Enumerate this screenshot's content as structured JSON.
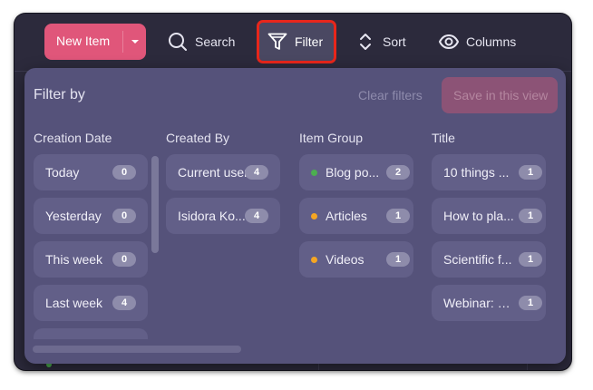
{
  "toolbar": {
    "new_item_label": "New Item",
    "search_label": "Search",
    "filter_label": "Filter",
    "sort_label": "Sort",
    "columns_label": "Columns"
  },
  "filter_panel": {
    "title": "Filter by",
    "clear_label": "Clear filters",
    "save_label": "Save in this view",
    "columns": [
      {
        "header": "Creation Date",
        "options": [
          {
            "label": "Today",
            "count": "0"
          },
          {
            "label": "Yesterday",
            "count": "0"
          },
          {
            "label": "This week",
            "count": "0"
          },
          {
            "label": "Last week",
            "count": "4"
          }
        ]
      },
      {
        "header": "Created By",
        "options": [
          {
            "label": "Current user",
            "count": "4"
          },
          {
            "label": "Isidora Ko...",
            "count": "4"
          }
        ]
      },
      {
        "header": "Item Group",
        "options": [
          {
            "label": "Blog po...",
            "count": "2",
            "dot_color": "#4caf50"
          },
          {
            "label": "Articles",
            "count": "1",
            "dot_color": "#f5a623"
          },
          {
            "label": "Videos",
            "count": "1",
            "dot_color": "#f5a623"
          }
        ]
      },
      {
        "header": "Title",
        "options": [
          {
            "label": "10 things ...",
            "count": "1"
          },
          {
            "label": "How to pla...",
            "count": "1"
          },
          {
            "label": "Scientific f...",
            "count": "1"
          },
          {
            "label": "Webinar: P...",
            "count": "1"
          }
        ]
      }
    ]
  },
  "icons": [
    "chevron-down-icon",
    "search-icon",
    "filter-funnel-icon",
    "sort-arrows-icon",
    "eye-icon"
  ],
  "colors": {
    "window_bg": "#2c2a3c",
    "panel_bg": "#55527a",
    "chip_bg": "#625f88",
    "accent": "#e0567a",
    "highlight": "#e8261b"
  }
}
